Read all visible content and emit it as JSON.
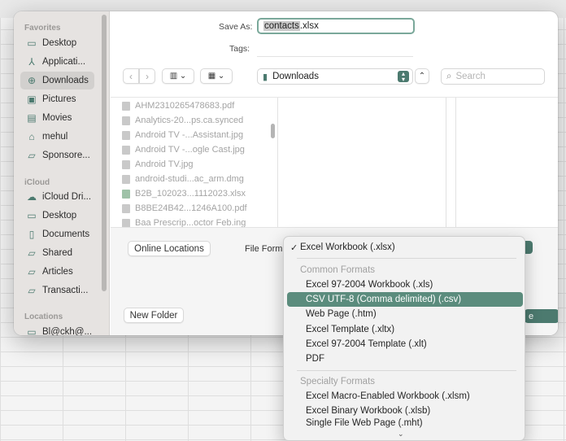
{
  "sidebar": {
    "favorites_title": "Favorites",
    "favorites": [
      {
        "label": "Desktop",
        "icon": "desktop-icon"
      },
      {
        "label": "Applicati...",
        "icon": "applications-icon"
      },
      {
        "label": "Downloads",
        "icon": "downloads-icon",
        "active": true
      },
      {
        "label": "Pictures",
        "icon": "pictures-icon"
      },
      {
        "label": "Movies",
        "icon": "movies-icon"
      },
      {
        "label": "mehul",
        "icon": "home-icon"
      },
      {
        "label": "Sponsore...",
        "icon": "folder-icon"
      }
    ],
    "icloud_title": "iCloud",
    "icloud": [
      {
        "label": "iCloud Dri...",
        "icon": "icloud-icon"
      },
      {
        "label": "Desktop",
        "icon": "desktop-icon"
      },
      {
        "label": "Documents",
        "icon": "documents-icon"
      },
      {
        "label": "Shared",
        "icon": "shared-folder-icon"
      },
      {
        "label": "Articles",
        "icon": "folder-icon"
      },
      {
        "label": "Transacti...",
        "icon": "folder-icon"
      }
    ],
    "locations_title": "Locations",
    "locations": [
      {
        "label": "Bl@ckh@...",
        "icon": "disk-icon"
      }
    ]
  },
  "header": {
    "save_as_label": "Save As:",
    "filename_selected": "contacts",
    "filename_ext": ".xlsx",
    "tags_label": "Tags:"
  },
  "toolbar": {
    "location": "Downloads",
    "search_placeholder": "Search"
  },
  "files": [
    "AHM2310265478683.pdf",
    "Analytics-20...ps.ca.synced",
    "Android TV -...Assistant.jpg",
    "Android TV -...ogle Cast.jpg",
    "Android TV.jpg",
    "android-studi...ac_arm.dmg",
    "B2B_102023...1112023.xlsx",
    "B8BE24B42...1246A100.pdf",
    "Baa Prescrip...octor Feb.ing"
  ],
  "bottom": {
    "online_locations": "Online Locations",
    "file_format_label": "File Form",
    "new_folder": "New Folder",
    "save_fragment": "e"
  },
  "format_menu": {
    "selected": "Excel Workbook (.xlsx)",
    "common_header": "Common Formats",
    "common": [
      "Excel 97-2004 Workbook (.xls)",
      "CSV UTF-8 (Comma delimited) (.csv)",
      "Web Page (.htm)",
      "Excel Template (.xltx)",
      "Excel 97-2004 Template (.xlt)",
      "PDF"
    ],
    "highlighted": "CSV UTF-8 (Comma delimited) (.csv)",
    "specialty_header": "Specialty Formats",
    "specialty": [
      "Excel Macro-Enabled Workbook (.xlsm)",
      "Excel Binary Workbook (.xlsb)",
      "Single File Web Page (.mht)"
    ]
  },
  "colors": {
    "accent": "#4c7a6f",
    "highlight": "#5b8c7d"
  }
}
